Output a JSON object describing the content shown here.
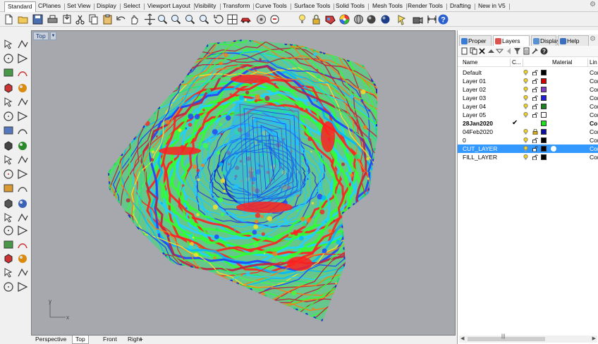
{
  "tabs": [
    {
      "label": "Standard",
      "active": true
    },
    {
      "label": "CPlanes"
    },
    {
      "label": "Set View"
    },
    {
      "label": "Display"
    },
    {
      "label": "Select"
    },
    {
      "label": "Viewport Layout"
    },
    {
      "label": "Visibility"
    },
    {
      "label": "Transform"
    },
    {
      "label": "Curve Tools"
    },
    {
      "label": "Surface Tools"
    },
    {
      "label": "Solid Tools"
    },
    {
      "label": "Mesh Tools"
    },
    {
      "label": "Render Tools"
    },
    {
      "label": "Drafting"
    },
    {
      "label": "New in V5"
    }
  ],
  "toolbar_icons": [
    "new-icon",
    "open-icon",
    "save-icon",
    "print-icon",
    "import-icon",
    "cut-icon",
    "copy-icon",
    "paste-icon",
    "undo-icon",
    "pan-icon",
    "move-view-icon",
    "zoom-window-icon",
    "zoom-dynamic-icon",
    "zoom-extents-icon",
    "zoom-selected-icon",
    "rotate-view-icon",
    "four-viewports-icon",
    "car-icon",
    "toggle-icon",
    "hide-icon",
    "light-icon",
    "lock-icon",
    "material-icon",
    "color-wheel-icon",
    "sphere-wireframe-icon",
    "sphere-shaded-icon",
    "sphere-render-icon",
    "render-icon",
    "render-preview-icon",
    "dimension-icon",
    "help-icon"
  ],
  "viewport": {
    "title": "Top",
    "axis_x": "x",
    "axis_y": "y"
  },
  "viewport_tabs": [
    {
      "label": "Perspective"
    },
    {
      "label": "Top",
      "active": true
    },
    {
      "label": "Front"
    },
    {
      "label": "Right"
    },
    {
      "label": "+"
    }
  ],
  "panel": {
    "tabs": [
      {
        "label": "Proper",
        "icon": "properties-icon",
        "color": "#3a7bd5"
      },
      {
        "label": "Layers",
        "icon": "layers-icon",
        "color": "#d9534f",
        "active": true
      },
      {
        "label": "Display",
        "icon": "display-icon",
        "color": "#5a8fd0"
      },
      {
        "label": "Help",
        "icon": "help-icon",
        "color": "#3a6fc0"
      }
    ],
    "columns": {
      "name": "Name",
      "current": "C...",
      "material": "Material",
      "linetype": "Lin"
    },
    "layers": [
      {
        "name": "Default",
        "color": "#000000",
        "linetype": "Con"
      },
      {
        "name": "Layer 01",
        "color": "#cc0000",
        "linetype": "Con"
      },
      {
        "name": "Layer 02",
        "color": "#8040c0",
        "linetype": "Con"
      },
      {
        "name": "Layer 03",
        "color": "#2020d0",
        "linetype": "Con"
      },
      {
        "name": "Layer 04",
        "color": "#208020",
        "linetype": "Con"
      },
      {
        "name": "Layer 05",
        "color": "#ffffff",
        "linetype": "Con"
      },
      {
        "name": "28Jan2020",
        "color": "#22dd22",
        "linetype": "Con",
        "current": true,
        "check": "✔"
      },
      {
        "name": "04Feb2020",
        "color": "#1010a0",
        "linetype": "Con",
        "locked": true
      },
      {
        "name": "0",
        "color": "#000000",
        "linetype": "Con"
      },
      {
        "name": "CUT_LAYER",
        "color": "#000000",
        "linetype": "Con",
        "selected": true
      },
      {
        "name": "FILL_LAYER",
        "color": "#000000",
        "linetype": "Con"
      }
    ],
    "scroll_grip": "|||"
  }
}
